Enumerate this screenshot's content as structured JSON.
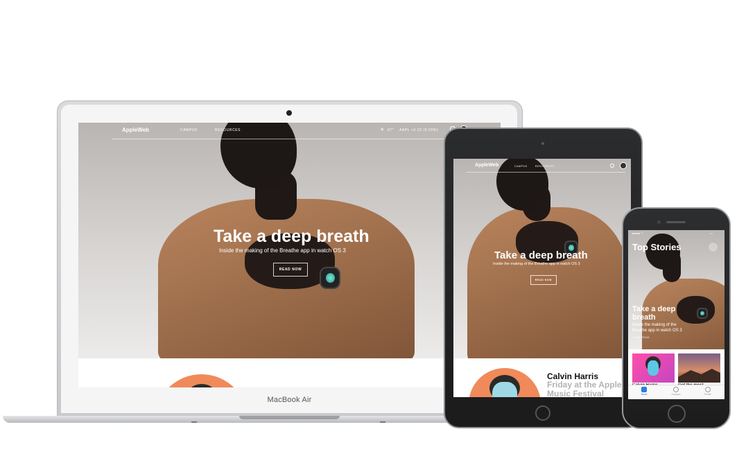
{
  "macbook": {
    "device_label": "MacBook Air",
    "nav": {
      "logo": "",
      "brand": "AppleWeb",
      "links": [
        "CAMPUS",
        "RESOURCES"
      ],
      "weather": "87°",
      "stock": "AAPL +0.22 (0.50%)"
    },
    "hero": {
      "title": "Take a deep breath",
      "subtitle": "Inside the making of the Breathe app in watch OS 3",
      "cta": "READ NOW"
    }
  },
  "ipad": {
    "nav": {
      "logo": "",
      "brand": "AppleWeb",
      "links": [
        "CAMPUS",
        "RESOURCES"
      ]
    },
    "hero": {
      "title": "Take a deep breath",
      "subtitle": "Inside the making of the Breathe app in watch OS 3",
      "cta": "READ NOW"
    },
    "feature": {
      "name": "Calvin Harris",
      "headline": "Friday at the Apple Music Festival"
    }
  },
  "iphone": {
    "page_title": "Top Stories",
    "hero": {
      "title": "Take a deep breath",
      "subtitle": "Inside the making of the Breathe app in watch OS 3",
      "meta": "3 MIN READ"
    },
    "cards": [
      "Calvin Harris",
      "Get the most"
    ],
    "tabs": [
      {
        "label": "News",
        "active": true
      },
      {
        "label": "Campus",
        "active": false
      },
      {
        "label": "Profile",
        "active": false
      }
    ]
  },
  "colors": {
    "shirt": "#a9754f",
    "skin": "#1d1715",
    "accent": "#2f7de1",
    "orange": "#f08a5a",
    "teal_glow": "#7ee3d6"
  }
}
